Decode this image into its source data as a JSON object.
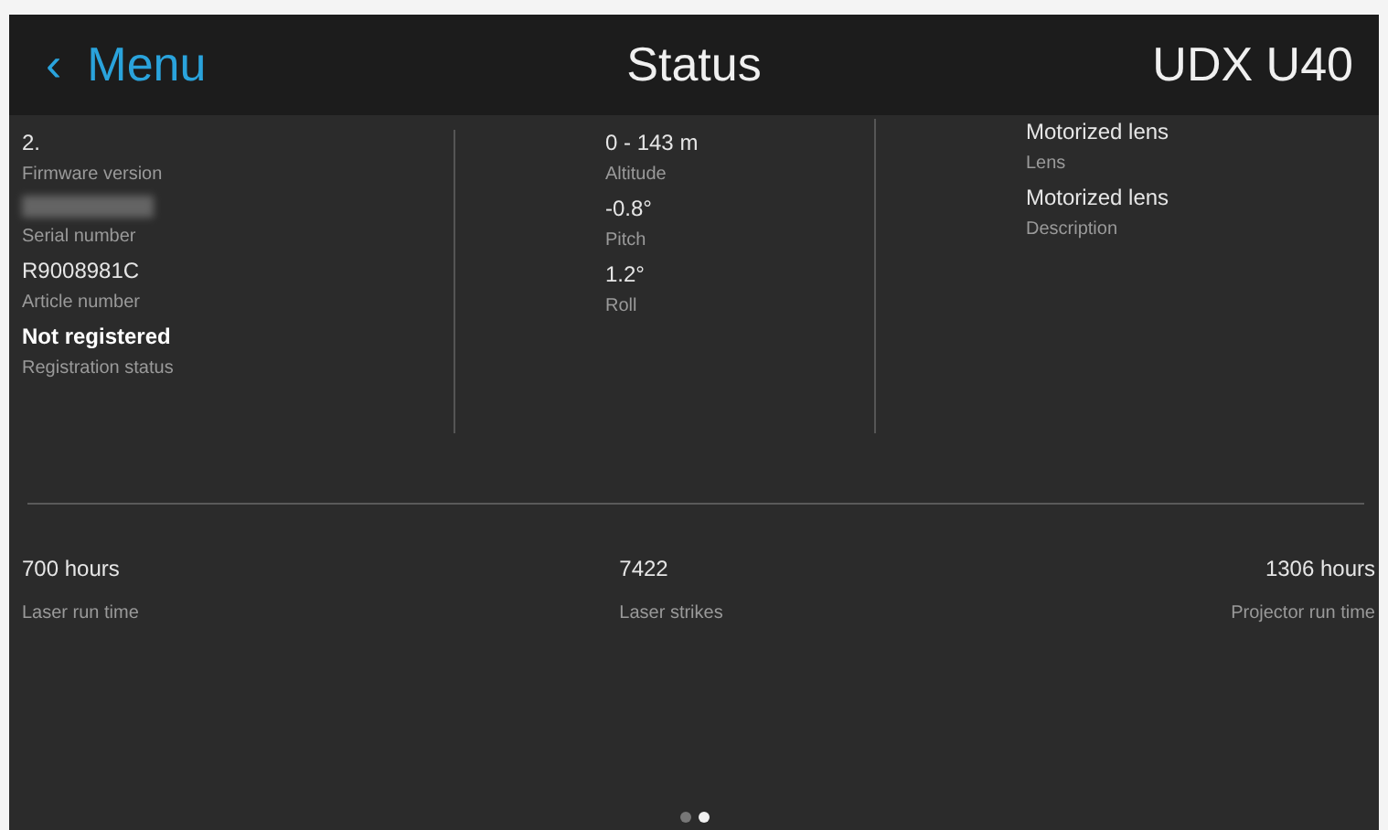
{
  "header": {
    "back_icon": "‹",
    "back_label": "Menu",
    "title": "Status",
    "device": "UDX U40"
  },
  "columns": [
    {
      "fields": [
        {
          "kind": "text",
          "value": "2.",
          "label": "Firmware version"
        },
        {
          "kind": "redacted",
          "label": "Serial number"
        },
        {
          "kind": "text",
          "value": "R9008981C",
          "label": "Article number"
        },
        {
          "kind": "highlight",
          "value": "Not registered",
          "label": "Registration status"
        }
      ]
    },
    {
      "fields": [
        {
          "kind": "text",
          "value": "0 - 143 m",
          "label": "Altitude"
        },
        {
          "kind": "text",
          "value": "-0.8°",
          "label": "Pitch"
        },
        {
          "kind": "text",
          "value": "1.2°",
          "label": "Roll"
        }
      ]
    },
    {
      "fields": [
        {
          "kind": "text",
          "value": "Motorized lens",
          "label": "Lens"
        },
        {
          "kind": "text",
          "value": "Motorized lens",
          "label": "Description"
        }
      ]
    }
  ],
  "counters": [
    {
      "value": "700 hours",
      "label": "Laser run time"
    },
    {
      "value": "7422",
      "label": "Laser strikes"
    },
    {
      "value": "1306 hours",
      "label": "Projector run time"
    }
  ],
  "pages": [
    {
      "selected": false
    },
    {
      "selected": true
    }
  ]
}
